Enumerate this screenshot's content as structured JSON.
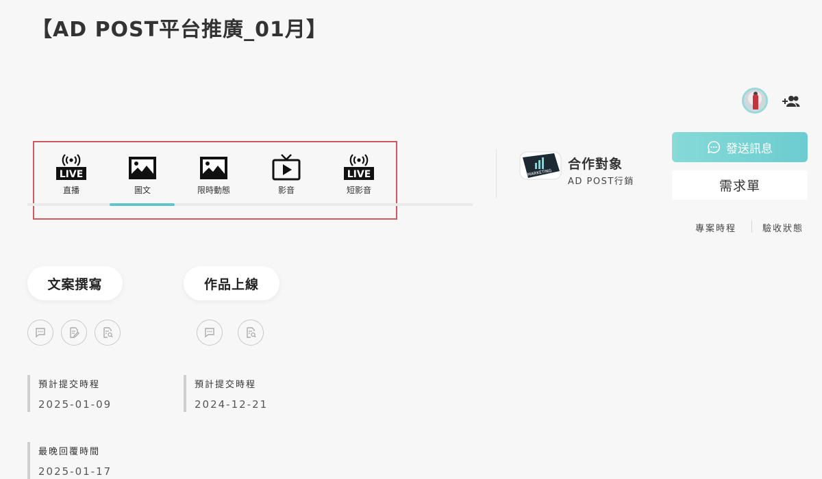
{
  "page": {
    "title": "【AD POST平台推廣_01月】"
  },
  "header": {
    "avatar_icon": "user-avatar",
    "add_member_icon": "group-add-icon"
  },
  "content_types": {
    "tabs": [
      {
        "label": "直播",
        "icon": "live-broadcast-icon",
        "badge": "LIVE"
      },
      {
        "label": "圖文",
        "icon": "image-icon",
        "active": true
      },
      {
        "label": "限時動態",
        "icon": "image-icon"
      },
      {
        "label": "影音",
        "icon": "video-play-icon"
      },
      {
        "label": "短影音",
        "icon": "live-broadcast-icon",
        "badge": "LIVE"
      }
    ],
    "active_color": "#5fc6c8"
  },
  "partner": {
    "label": "合作對象",
    "name": "AD POST行銷",
    "logo_text": "MARKETING"
  },
  "actions": {
    "send_message": "發送訊息",
    "requirements": "需求單",
    "accent": "#6ccccf"
  },
  "links": {
    "project_schedule": "專案時程",
    "acceptance_status": "驗收狀態"
  },
  "stages": [
    {
      "title": "文案撰寫",
      "icons": [
        "chat-icon",
        "edit-document-icon",
        "document-search-icon"
      ],
      "info": [
        {
          "label": "預計提交時程",
          "value": "2025-01-09"
        },
        {
          "label": "最晚回覆時間",
          "value": "2025-01-17"
        }
      ]
    },
    {
      "title": "作品上線",
      "icons": [
        "chat-icon",
        "document-search-icon"
      ],
      "info": [
        {
          "label": "預計提交時程",
          "value": "2024-12-21"
        }
      ]
    }
  ]
}
